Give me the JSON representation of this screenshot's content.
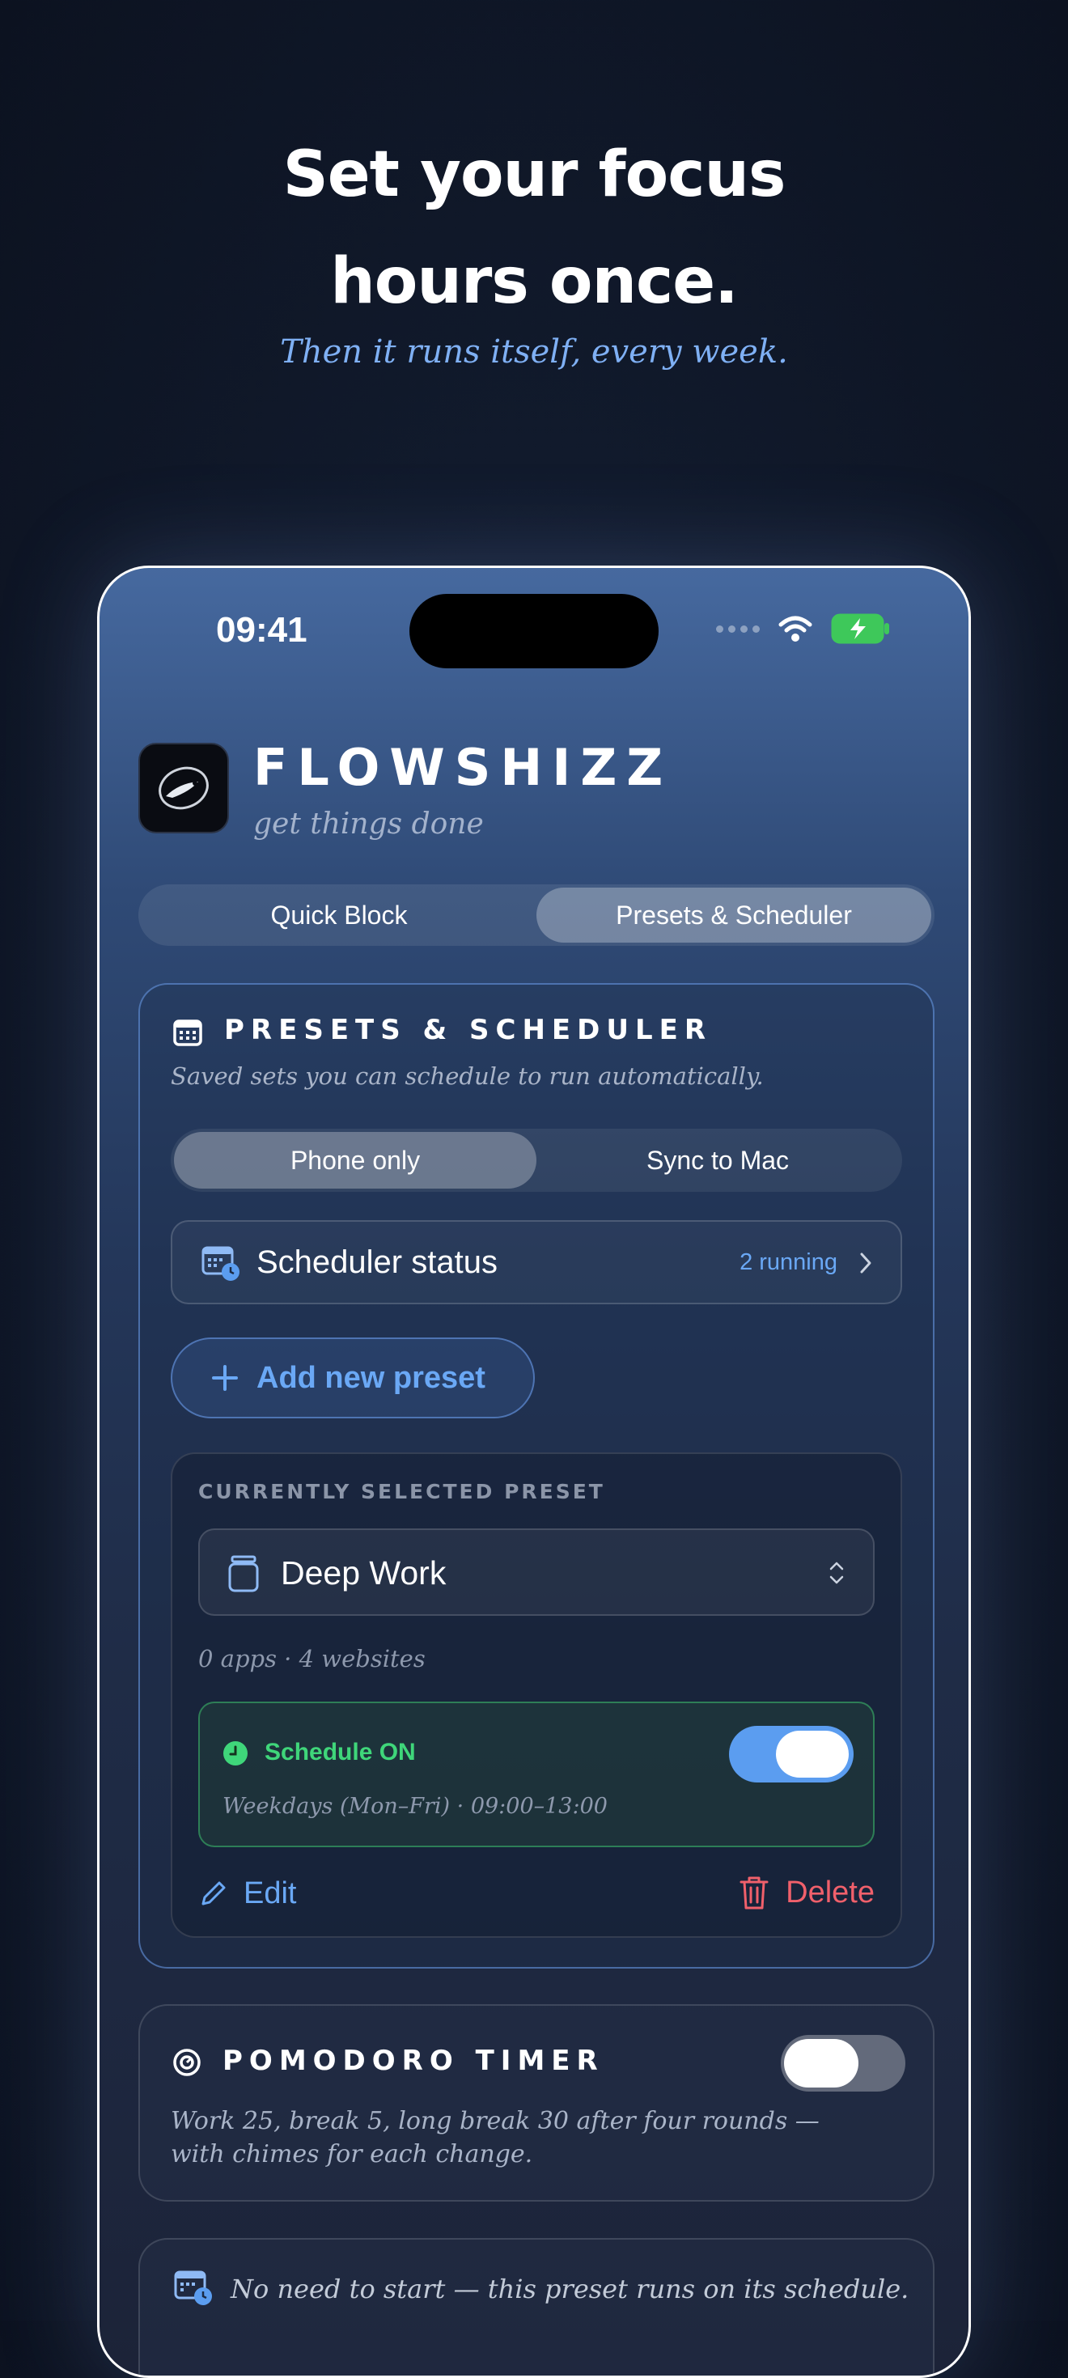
{
  "marketing": {
    "headline_line1": "Set your focus",
    "headline_line2": "hours once.",
    "subline": "Then it runs itself, every week."
  },
  "status_bar": {
    "time": "09:41"
  },
  "app": {
    "name": "FLOWSHIZZ",
    "tagline": "get things done"
  },
  "main_tabs": [
    {
      "label": "Quick Block",
      "active": false
    },
    {
      "label": "Presets & Scheduler",
      "active": true
    }
  ],
  "presets_section": {
    "title": "PRESETS & SCHEDULER",
    "description": "Saved sets you can schedule to run automatically.",
    "sync_options": [
      {
        "label": "Phone only",
        "active": true
      },
      {
        "label": "Sync to Mac",
        "active": false
      }
    ],
    "scheduler_status": {
      "label": "Scheduler status",
      "count": "2 running"
    },
    "add_preset_label": "Add new preset",
    "selected": {
      "heading": "CURRENTLY SELECTED PRESET",
      "preset_name": "Deep Work",
      "summary": "0 apps · 4 websites",
      "schedule": {
        "label": "Schedule ON",
        "enabled": true,
        "details": "Weekdays (Mon–Fri) · 09:00–13:00"
      },
      "edit_label": "Edit",
      "delete_label": "Delete"
    }
  },
  "pomodoro": {
    "title": "POMODORO TIMER",
    "enabled": false,
    "description": "Work 25, break 5, long break 30 after four rounds — with chimes for each change."
  },
  "info_note": "No need to start — this preset runs on its schedule.",
  "colors": {
    "accent_blue": "#6aa8f5",
    "schedule_green": "#3fd67a",
    "delete_red": "#f0606b",
    "toggle_on": "#5b9df0"
  }
}
